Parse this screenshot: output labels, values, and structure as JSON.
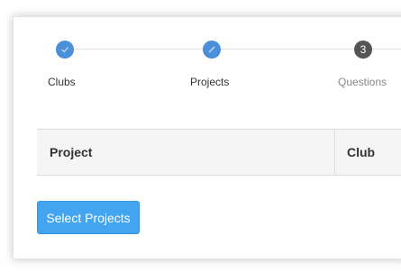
{
  "stepper": {
    "steps": [
      {
        "label": "Clubs",
        "state": "completed",
        "icon": "check-icon"
      },
      {
        "label": "Projects",
        "state": "current",
        "icon": "pencil-icon"
      },
      {
        "label": "Questions",
        "state": "pending",
        "number": "3"
      }
    ]
  },
  "table": {
    "columns": [
      "Project",
      "Club"
    ]
  },
  "actions": {
    "select_projects_label": "Select Projects"
  },
  "colors": {
    "accent": "#4a90d9",
    "button": "#43a4ef",
    "pending": "#555555"
  }
}
